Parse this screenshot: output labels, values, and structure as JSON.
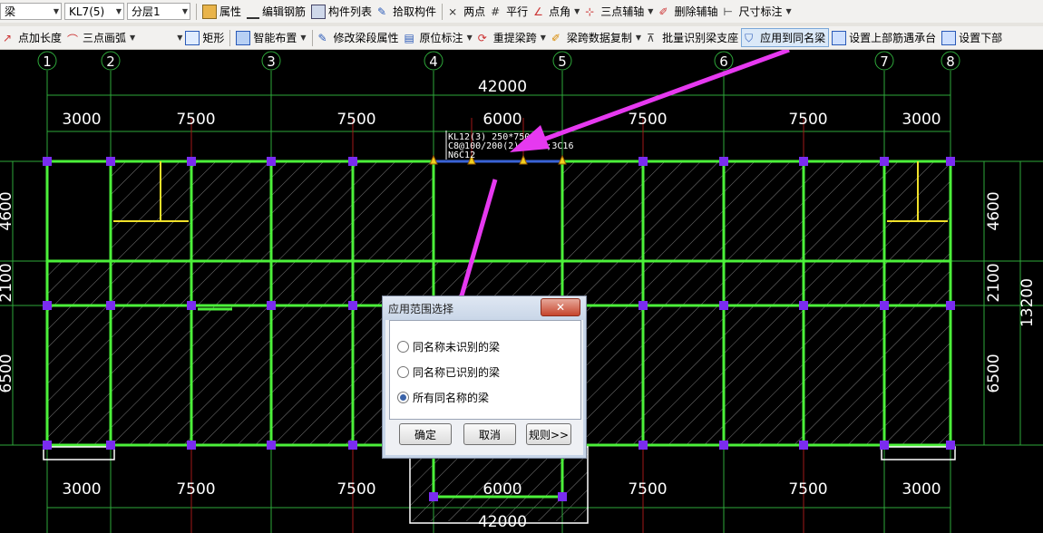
{
  "toolbar1": {
    "type_combo": "梁",
    "member_combo": "KL7(5)",
    "layer_combo": "分层1",
    "buttons": [
      "属性",
      "编辑钢筋",
      "构件列表",
      "拾取构件",
      "两点",
      "平行",
      "点角",
      "三点辅轴",
      "删除辅轴",
      "尺寸标注"
    ]
  },
  "toolbar2": {
    "buttons": [
      "点加长度",
      "三点画弧",
      "矩形",
      "智能布置",
      "修改梁段属性",
      "原位标注",
      "重提梁跨",
      "梁跨数据复制",
      "批量识别梁支座",
      "应用到同名梁",
      "设置上部筋遇承台",
      "设置下部"
    ]
  },
  "drawing": {
    "axis_labels": [
      "1",
      "2",
      "3",
      "4",
      "5",
      "6",
      "7",
      "8"
    ],
    "total_top": "42000",
    "total_bottom": "42000",
    "span_dims_top": [
      "3000",
      "7500",
      "7500",
      "6000",
      "7500",
      "7500",
      "3000"
    ],
    "span_dims_bottom": [
      "3000",
      "7500",
      "7500",
      "6000",
      "7500",
      "7500",
      "3000"
    ],
    "left_dims": [
      "4600",
      "2100",
      "6500"
    ],
    "right_dims": [
      "4600",
      "2100",
      "6500"
    ],
    "right_total": "13200",
    "beam_label_line1": "KL12(3) 250*750",
    "beam_label_line2": "C8@100/200(2) 2C16;3C16",
    "beam_label_line3": "N6C12"
  },
  "dialog": {
    "title": "应用范围选择",
    "close": "✕",
    "options": [
      "同名称未识别的梁",
      "同名称已识别的梁",
      "所有同名称的梁"
    ],
    "selected": 2,
    "ok": "确定",
    "cancel": "取消",
    "rules": "规则>>"
  },
  "colors": {
    "beam": "#4cf03a",
    "highlight_beam": "#3a63d6",
    "column": "#7a2cf0",
    "axis": "#2ea83a",
    "annotation_arrow": "#e639f0",
    "yellow": "#f0e02a"
  }
}
